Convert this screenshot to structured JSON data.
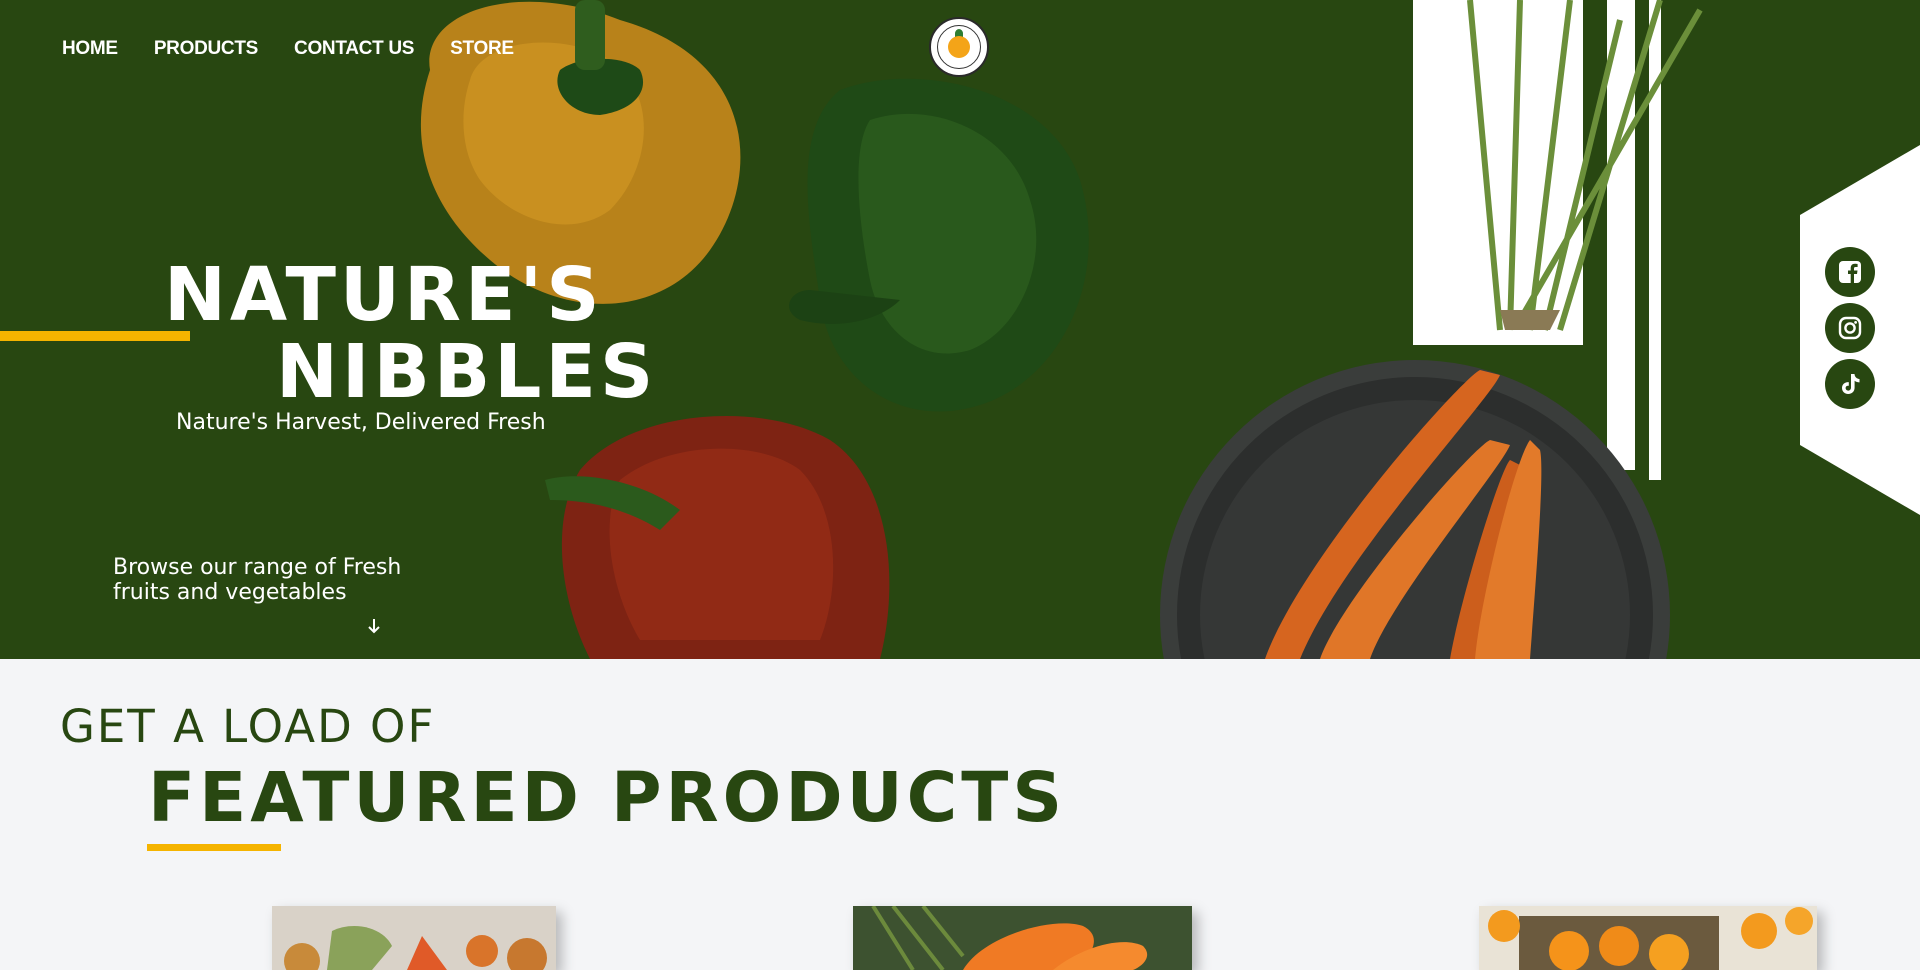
{
  "nav": {
    "items": [
      {
        "label": "HOME"
      },
      {
        "label": "PRODUCTS"
      },
      {
        "label": "CONTACT US"
      },
      {
        "label": "STORE"
      }
    ]
  },
  "logo": {
    "text": "NATURE'S NIBBLES"
  },
  "hero": {
    "title_line1": "NATURE'S",
    "title_line2": "NIBBLES",
    "tagline": "Nature's Harvest, Delivered Fresh",
    "browse_line1": "Browse our range of Fresh",
    "browse_line2": "fruits and vegetables",
    "scroll_icon": "arrow-down-icon"
  },
  "social": [
    {
      "name": "facebook-icon"
    },
    {
      "name": "instagram-icon"
    },
    {
      "name": "tiktok-icon"
    }
  ],
  "featured": {
    "subtitle": "GET A LOAD OF",
    "title": "FEATURED PRODUCTS"
  },
  "colors": {
    "brand_green": "#284711",
    "accent_yellow": "#f5b400",
    "background": "#f4f5f7"
  }
}
